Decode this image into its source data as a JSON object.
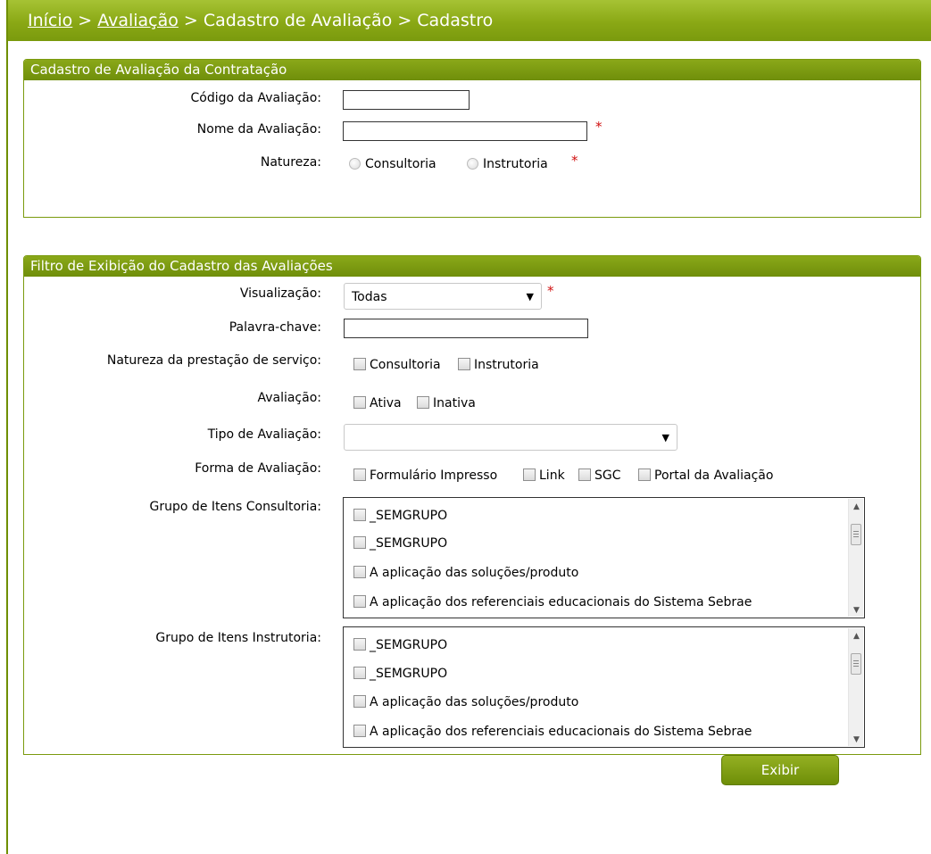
{
  "breadcrumb": {
    "items": [
      "Início",
      "Avaliação",
      "Cadastro de Avaliação",
      "Cadastro"
    ],
    "separator": ">"
  },
  "panel1": {
    "title": "Cadastro de Avaliação da Contratação",
    "codigo_label": "Código da Avaliação:",
    "codigo_value": "",
    "nome_label": "Nome da Avaliação:",
    "nome_value": "",
    "natureza_label": "Natureza:",
    "natureza_options": [
      "Consultoria",
      "Instrutoria"
    ],
    "required_mark": "*"
  },
  "panel2": {
    "title": "Filtro de Exibição do Cadastro das Avaliações",
    "visualizacao_label": "Visualização:",
    "visualizacao_value": "Todas",
    "palavra_label": "Palavra-chave:",
    "palavra_value": "",
    "natureza_label": "Natureza da prestação de serviço:",
    "natureza_options": [
      "Consultoria",
      "Instrutoria"
    ],
    "avaliacao_label": "Avaliação:",
    "avaliacao_options": [
      "Ativa",
      "Inativa"
    ],
    "tipo_label": "Tipo de Avaliação:",
    "tipo_value": "",
    "forma_label": "Forma de Avaliação:",
    "forma_options": [
      "Formulário Impresso",
      "Link",
      "SGC",
      "Portal da Avaliação"
    ],
    "grupo_consultoria_label": "Grupo de Itens Consultoria:",
    "grupo_consultoria_items": [
      "_SEMGRUPO",
      "_SEMGRUPO",
      "A aplicação das soluções/produto",
      "A aplicação dos referenciais educacionais do Sistema Sebrae"
    ],
    "grupo_instrutoria_label": "Grupo de Itens Instrutoria:",
    "grupo_instrutoria_items": [
      "_SEMGRUPO",
      "_SEMGRUPO",
      "A aplicação das soluções/produto",
      "A aplicação dos referenciais educacionais do Sistema Sebrae"
    ],
    "exibir_label": "Exibir",
    "required_mark": "*"
  },
  "colors": {
    "accent": "#7a9a0d",
    "required": "#d01010"
  }
}
